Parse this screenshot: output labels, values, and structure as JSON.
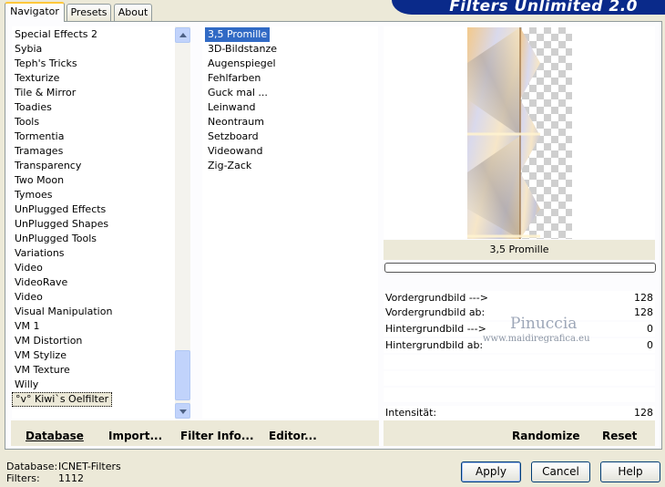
{
  "banner": {
    "title": "Filters Unlimited 2.0"
  },
  "tabs": [
    {
      "label": "Navigator",
      "active": true
    },
    {
      "label": "Presets",
      "active": false
    },
    {
      "label": "About",
      "active": false
    }
  ],
  "categories": [
    "Special Effects 2",
    "Sybia",
    "Teph's Tricks",
    "Texturize",
    "Tile & Mirror",
    "Toadies",
    "Tools",
    "Tormentia",
    "Tramages",
    "Transparency",
    "Two Moon",
    "Tymoes",
    "UnPlugged Effects",
    "UnPlugged Shapes",
    "UnPlugged Tools",
    "Variations",
    "Video",
    "VideoRave",
    "Video",
    "Visual Manipulation",
    "VM 1",
    "VM Distortion",
    "VM Stylize",
    "VM Texture",
    "Willy",
    "°v° Kiwi`s Oelfilter"
  ],
  "filters": [
    "3,5 Promille",
    "3D-Bildstanze",
    "Augenspiegel",
    "Fehlfarben",
    "Guck mal ...",
    "Leinwand",
    "Neontraum",
    "Setzboard",
    "Videowand",
    "Zig-Zack"
  ],
  "preview": {
    "filter_name": "3,5 Promille"
  },
  "watermark": {
    "name": "Pinuccia",
    "url": "www.maidiregrafica.eu"
  },
  "parameters": [
    {
      "label": "Vordergrundbild --->",
      "value": "128"
    },
    {
      "label": "Vordergrundbild ab:",
      "value": "128"
    },
    {
      "label": "Hintergrundbild --->",
      "value": "0"
    },
    {
      "label": "Hintergrundbild ab:",
      "value": "0"
    },
    {
      "label": "",
      "value": ""
    },
    {
      "label": "",
      "value": ""
    },
    {
      "label": "",
      "value": ""
    },
    {
      "label": "Intensität:",
      "value": "128"
    }
  ],
  "toolbar_left": {
    "database": "Database",
    "import": "Import...",
    "filter_info": "Filter Info...",
    "editor": "Editor..."
  },
  "toolbar_right": {
    "randomize": "Randomize",
    "reset": "Reset"
  },
  "status": {
    "database_label": "Database:",
    "database_value": "ICNET-Filters",
    "filters_label": "Filters:",
    "filters_value": "1112"
  },
  "buttons": {
    "apply": "Apply",
    "cancel": "Cancel",
    "help": "Help"
  }
}
